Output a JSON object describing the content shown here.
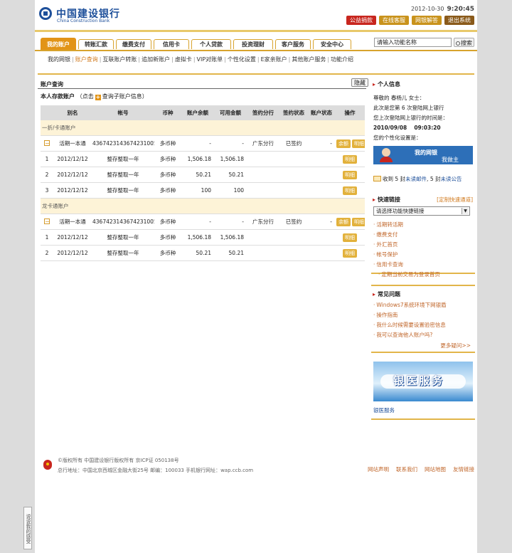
{
  "header": {
    "brand_cn": "中国建设银行",
    "brand_en": "China Construction Bank",
    "date": "2012-10-30",
    "time": "9:20:45",
    "buttons": [
      "公益捐款",
      "在线客服",
      "网银解答",
      "退出系统"
    ]
  },
  "nav": {
    "tabs": [
      "我的账户",
      "转账汇款",
      "缴费支付",
      "信用卡",
      "个人贷款",
      "投资理财",
      "客户服务",
      "安全中心"
    ],
    "active_tab": 0,
    "search_placeholder": "请输入功能名称",
    "search_button": "搜索"
  },
  "subnav": {
    "items": [
      "我的网银",
      "账户查询",
      "互联账户转账",
      "追加新账户",
      "虚拟卡",
      "VIP对账单",
      "个性化设置",
      "E家亲账户",
      "其他账户服务",
      "功能介绍"
    ],
    "active_index": 1
  },
  "main": {
    "section_title": "账户查询",
    "hide_button": "隐藏",
    "my_accounts_label": "本人存款账户",
    "click_hint_prefix": "（点击",
    "click_hint_suffix": "查询子账户信息）",
    "columns": [
      "别名",
      "帐号",
      "币种",
      "账户余额",
      "可用金额",
      "签约分行",
      "签约状态",
      "账户状态",
      "操作"
    ],
    "groups": [
      {
        "name": "一折/卡通账户",
        "main_row": {
          "alias": "活期一本通",
          "account": "4367423143674231005",
          "currency": "多币种",
          "balance": "-",
          "available": "-",
          "branch": "广东分行",
          "sign_status": "已签约",
          "acct_status": "-",
          "ops": [
            "余额",
            "明细"
          ]
        },
        "sub_rows": [
          {
            "idx": "1",
            "date": "2012/12/12",
            "type": "整存整取一年",
            "currency": "多币种",
            "balance": "1,506.18",
            "available": "1,506.18",
            "op": "明细"
          },
          {
            "idx": "2",
            "date": "2012/12/12",
            "type": "整存整取一年",
            "currency": "多币种",
            "balance": "50.21",
            "available": "50.21",
            "op": "明细"
          },
          {
            "idx": "3",
            "date": "2012/12/12",
            "type": "整存整取一年",
            "currency": "多币种",
            "balance": "100",
            "available": "100",
            "op": "明细"
          }
        ]
      },
      {
        "name": "龙卡通账户",
        "main_row": {
          "alias": "活期一本通",
          "account": "4367423143674231005",
          "currency": "多币种",
          "balance": "-",
          "available": "-",
          "branch": "广东分行",
          "sign_status": "已签约",
          "acct_status": "-",
          "ops": [
            "余额",
            "明细"
          ]
        },
        "sub_rows": [
          {
            "idx": "1",
            "date": "2012/12/12",
            "type": "整存整取一年",
            "currency": "多币种",
            "balance": "1,506.18",
            "available": "1,506.18",
            "op": "明细"
          },
          {
            "idx": "2",
            "date": "2012/12/12",
            "type": "整存整取一年",
            "currency": "多币种",
            "balance": "50.21",
            "available": "50.21",
            "op": "明细"
          }
        ]
      }
    ]
  },
  "sidebar": {
    "personal": {
      "title": "个人信息",
      "greeting": "尊敬的 春杨儿 女士：",
      "login_count": "此次是您第 6 次登陆网上银行",
      "last_login_label": "您上次登陆网上银行的时间是：",
      "last_login_time": "2010/09/08　 09:03:20",
      "setting_label": "您的个性化设置是：",
      "banner_a": "我的网银",
      "banner_b": "我做主",
      "unread_mail_prefix": "收到 5 封",
      "unread_mail": "未读邮件",
      "unread_notice_prefix": ", 5 封",
      "unread_notice": "未读公告"
    },
    "quick": {
      "title": "快速链接",
      "custom": "[定制快速通道]",
      "select_value": "请选择功能快捷链接",
      "links": [
        "活期转活期",
        "缴费支付",
        "外汇首页",
        "帐号保护",
        "信用卡查询",
        "定期当前交易为登录首页"
      ]
    },
    "faq": {
      "title": "常见问题",
      "links": [
        "Windows7系统环境下网银盾",
        "操作指南",
        "我什么时候需要设置验密信息",
        "我可以查询他人账户吗?"
      ],
      "more": "更多疑问>>"
    },
    "yiyi": {
      "banner": "银医服务",
      "label": "银医服务"
    }
  },
  "footer": {
    "line1": "©版权所有  中国建设银行版权所有  京ICP证 050138号",
    "line2": "总行地址：中国北京西城区金融大街25号  邮编：100033  手机银行网址：wap.ccb.com",
    "links": [
      "网站声明",
      "联系我们",
      "网站地图",
      "友情链接"
    ],
    "feedback": "说说我的感受"
  }
}
